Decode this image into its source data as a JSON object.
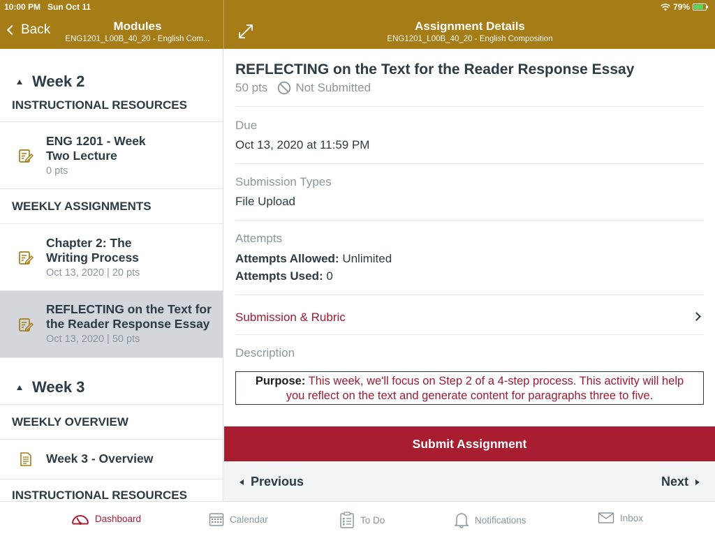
{
  "status_bar": {
    "time_date": "10:00 PM   Sun Oct 11",
    "battery": "79%",
    "battery_level": 0.79
  },
  "header": {
    "back_label": "Back",
    "left_title": "Modules",
    "left_subtitle": "ENG1201_L00B_40_20 - English Com...",
    "right_title": "Assignment Details",
    "right_subtitle": "ENG1201_L00B_40_20 - English Composition"
  },
  "colors": {
    "brand": "#a57c15",
    "accent": "#a81d2f",
    "selected": "#d3d6db"
  },
  "sidebar": {
    "week2_label": "Week 2",
    "instructional_resources_label": "INSTRUCTIONAL RESOURCES",
    "week2_lecture": {
      "title_line1": "ENG 1201 - Week",
      "title_line2": "Two Lecture",
      "meta": "0 pts",
      "icon": "assignment-icon"
    },
    "weekly_assignments_label": "WEEKLY ASSIGNMENTS",
    "chapter2": {
      "title_line1": "Chapter 2: The",
      "title_line2": "Writing Process",
      "meta": "Oct 13, 2020 | 20 pts",
      "icon": "assignment-icon"
    },
    "reflecting": {
      "title_line1": "REFLECTING on the Text for",
      "title_line2": "the Reader Response Essay",
      "meta": "Oct 13, 2020 | 50 pts",
      "icon": "assignment-icon"
    },
    "week3_label": "Week 3",
    "weekly_overview_label": "WEEKLY OVERVIEW",
    "week3_overview": {
      "title": "Week 3 - Overview",
      "icon": "page-icon"
    },
    "instructional_resources_label_2": "INSTRUCTIONAL RESOURCES"
  },
  "assignment": {
    "title": "REFLECTING on the Text for the Reader Response Essay",
    "points": "50 pts",
    "status": "Not Submitted",
    "due_label": "Due",
    "due_value": "Oct 13, 2020 at 11:59 PM",
    "submission_types_label": "Submission Types",
    "submission_types_value": "File Upload",
    "attempts_label": "Attempts",
    "attempts_allowed_key": "Attempts Allowed:",
    "attempts_allowed_value": "Unlimited",
    "attempts_used_key": "Attempts Used:",
    "attempts_used_value": "0",
    "submission_rubric_label": "Submission & Rubric",
    "description_label": "Description",
    "description_purpose": "Purpose:",
    "description_line1": "This week, we'll focus on Step 2 of a 4-step process. This activity will help",
    "description_line2": "you reflect on the text and generate content for paragraphs three to five.",
    "submit_label": "Submit Assignment",
    "previous_label": "Previous",
    "next_label": "Next"
  },
  "tabbar": {
    "dashboard": "Dashboard",
    "calendar": "Calendar",
    "todo": "To Do",
    "notifications": "Notifications",
    "inbox": "Inbox"
  }
}
